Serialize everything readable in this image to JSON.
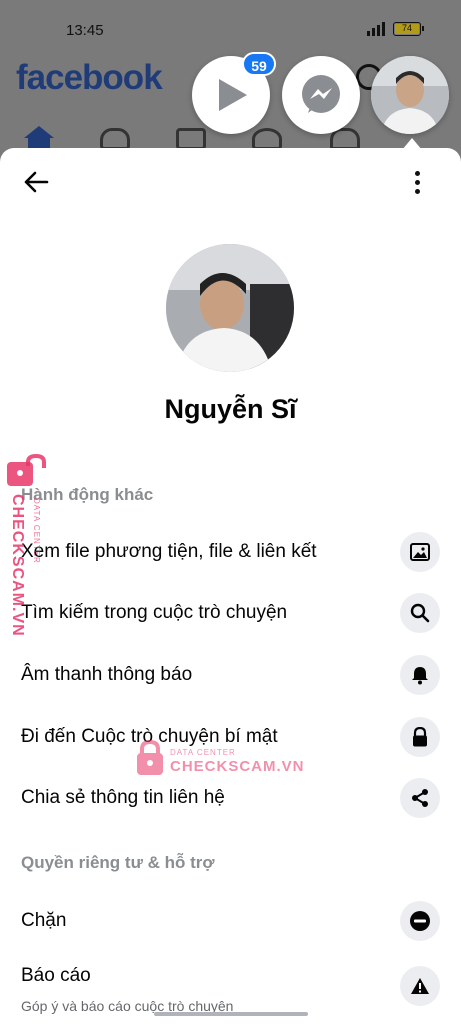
{
  "status": {
    "time": "13:45",
    "battery": "74"
  },
  "app": {
    "logo": "facebook"
  },
  "chat_heads": {
    "video_badge": "59"
  },
  "profile": {
    "name": "Nguyễn Sĩ"
  },
  "sections": {
    "actions_title": "Hành động khác",
    "privacy_title": "Quyền riêng tư & hỗ trợ"
  },
  "actions": [
    {
      "label": "Xem file phương tiện, file & liên kết",
      "icon": "image-icon"
    },
    {
      "label": "Tìm kiếm trong cuộc trò chuyện",
      "icon": "search-icon"
    },
    {
      "label": "Âm thanh thông báo",
      "icon": "bell-icon"
    },
    {
      "label": "Đi đến Cuộc trò chuyện bí mật",
      "icon": "lock-icon"
    },
    {
      "label": "Chia sẻ thông tin liên hệ",
      "icon": "share-icon"
    }
  ],
  "privacy": [
    {
      "label": "Chặn",
      "icon": "block-icon"
    },
    {
      "label": "Báo cáo",
      "sublabel": "Góp ý và báo cáo cuộc trò chuyện",
      "icon": "warning-icon"
    }
  ],
  "watermark": {
    "brand": "CHECKSCAM.VN",
    "sub": "DATA CENTER"
  },
  "colors": {
    "fb_blue": "#1877f2",
    "watermark_pink": "#e8376a"
  }
}
